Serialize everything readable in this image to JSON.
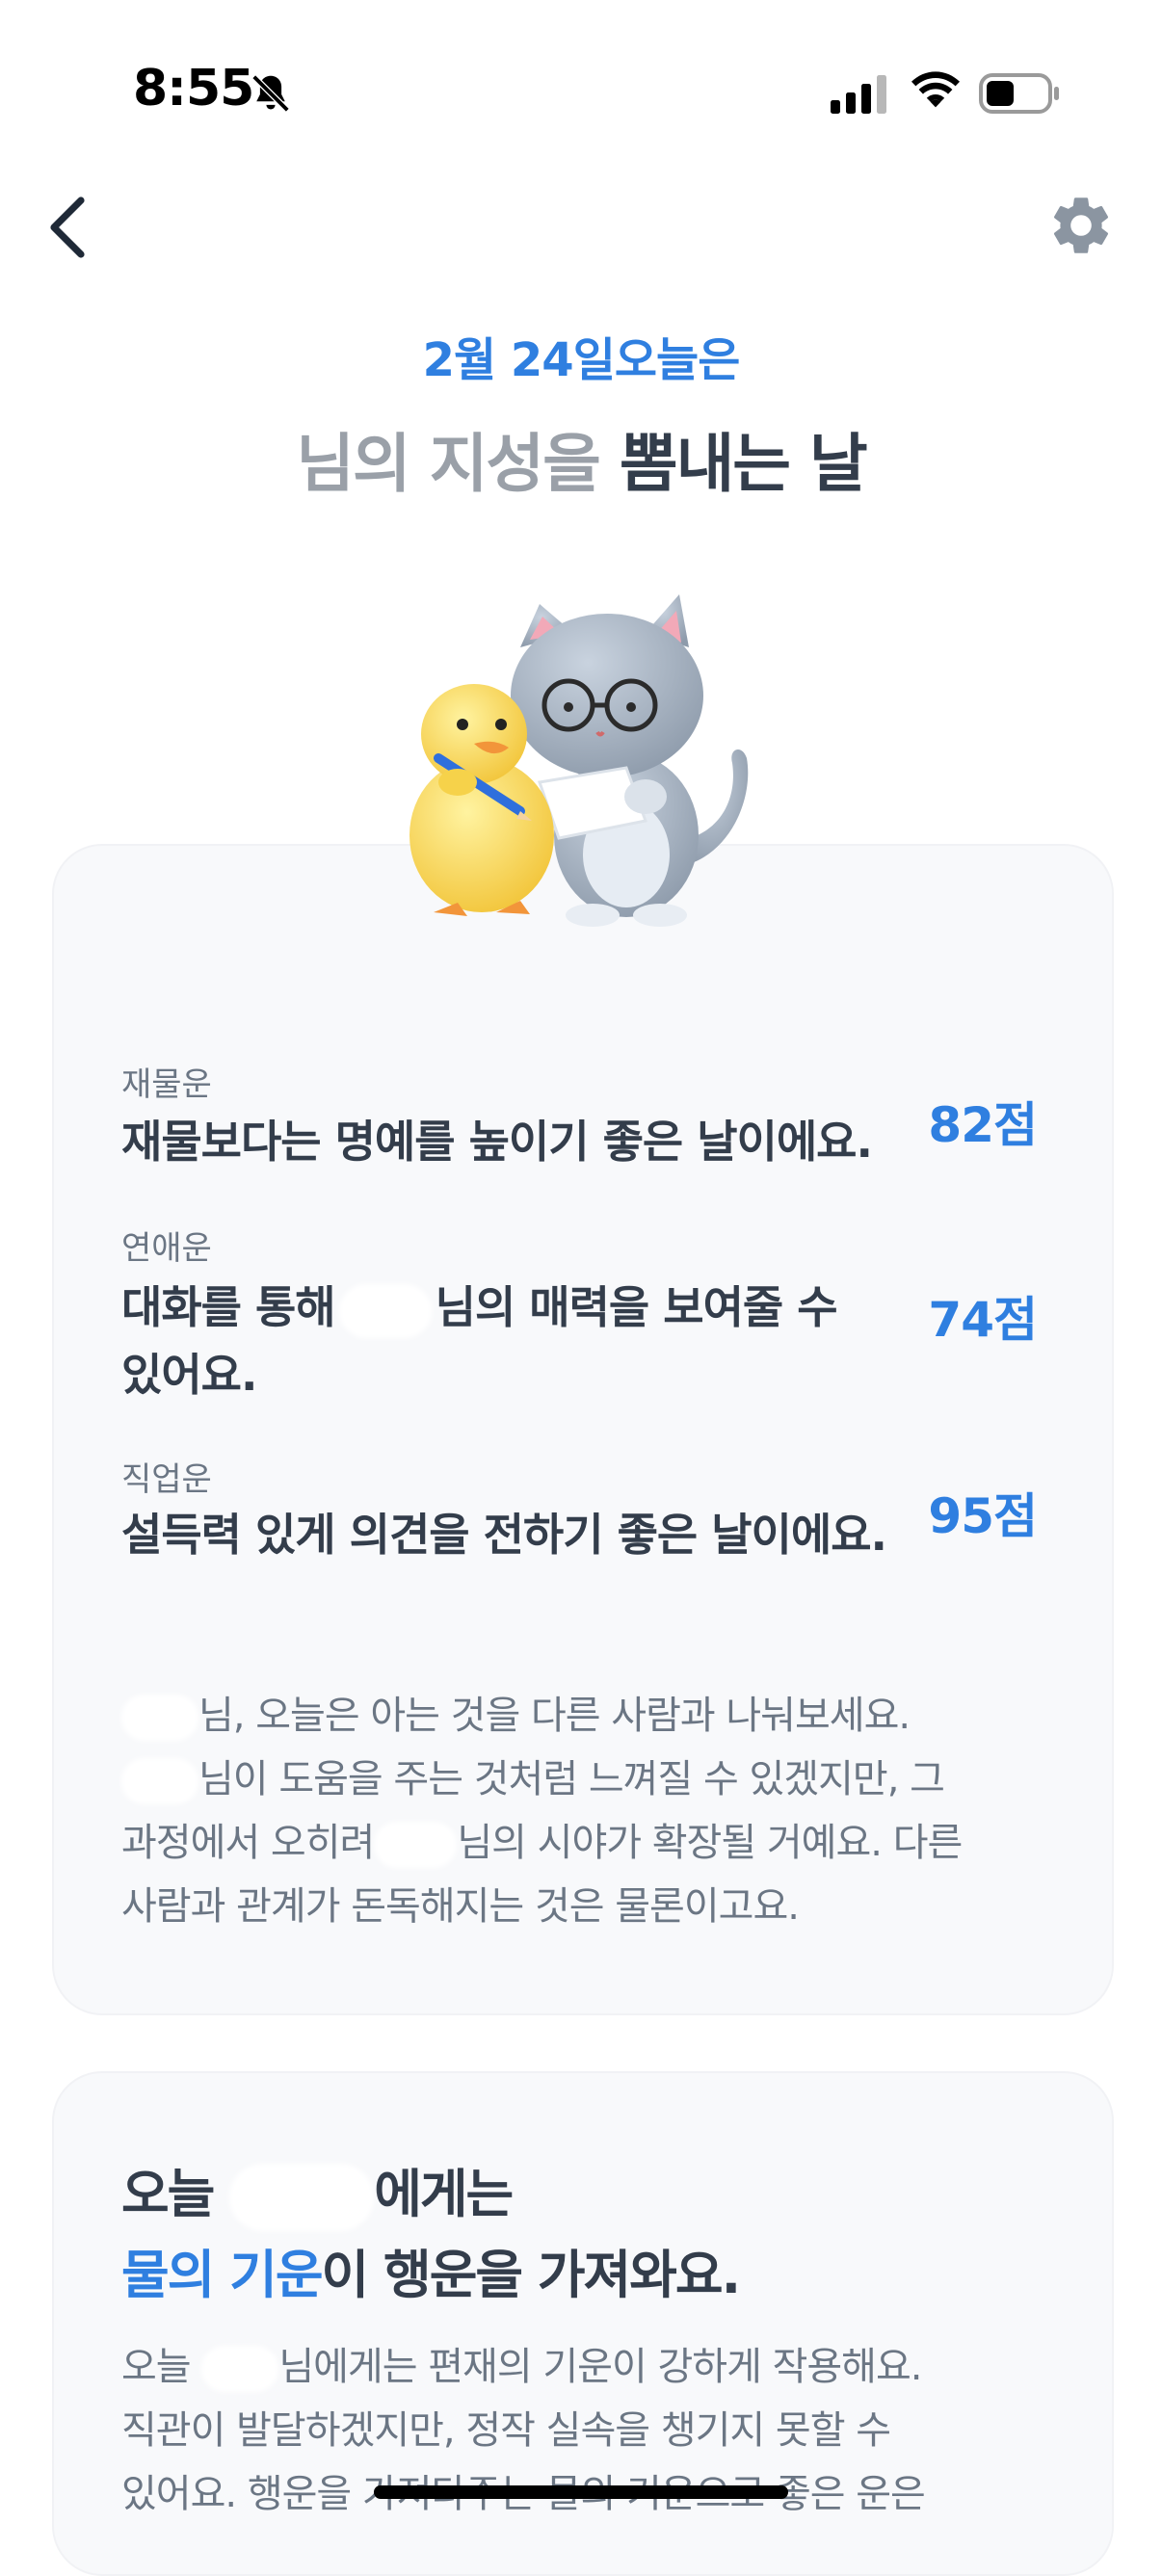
{
  "status_bar": {
    "time": "8:55",
    "icons": [
      "bell-slash-icon",
      "signal-icon",
      "wifi-icon",
      "battery-icon"
    ]
  },
  "nav": {
    "back_icon": "chevron-left-icon",
    "settings_icon": "gear-icon"
  },
  "header": {
    "date": "2월 24일",
    "today": "오늘은",
    "title_prefix": "님의 지성을",
    "title_suffix": "뽐내는 날"
  },
  "fortunes": [
    {
      "category": "재물운",
      "message": "재물보다는 명예를 높이기 좋은 날이에요.",
      "score": "82점"
    },
    {
      "category": "연애운",
      "message_before": "대화를 통해",
      "message_after": "님의 매력을 보여줄 수",
      "message_line2": "있어요.",
      "score": "74점"
    },
    {
      "category": "직업운",
      "message": "설득력 있게 의견을 전하기 좋은 날이에요.",
      "score": "95점"
    }
  ],
  "advice": {
    "line1": "님, 오늘은 아는 것을 다른 사람과 나눠보세요.",
    "line2": "님이 도움을 주는 것처럼 느껴질 수 있겠지만, 그",
    "line3_before": "과정에서 오히려",
    "line3_after": "님의 시야가 확장될 거예요. 다른",
    "line4": "사람과 관계가 돈독해지는 것은 물론이고요."
  },
  "lucky": {
    "title_prefix": "오늘",
    "title_suffix": "에게는",
    "element": "물의 기운",
    "title_line2": "이 행운을 가져와요.",
    "body_line1_before": "오늘",
    "body_line1_after": "님에게는 편재의 기운이 강하게 작용해요.",
    "body_line2": "직관이 발달하겠지만, 정작 실속을 챙기지 못할 수",
    "body_line3": "있어요. 행운을 가져다주는 물의 기운으로 좋은 운은"
  },
  "colors": {
    "accent": "#2f7fe0",
    "text": "#333d4b",
    "muted": "#6b7684",
    "card": "#f8f9fb"
  }
}
